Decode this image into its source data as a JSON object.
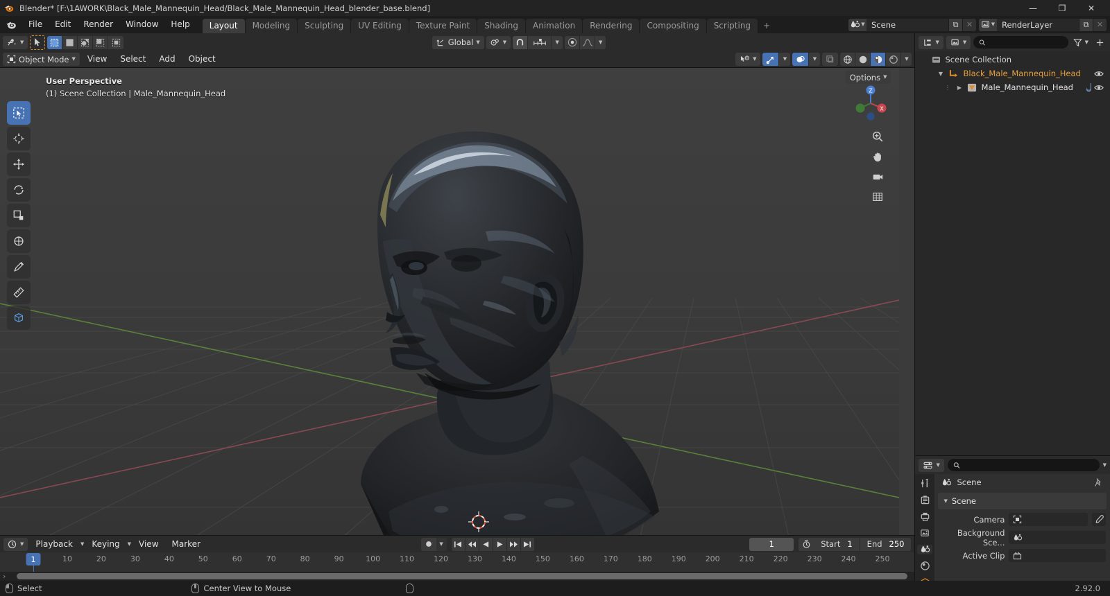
{
  "window": {
    "title": "Blender* [F:\\1AWORK\\Black_Male_Mannequin_Head/Black_Male_Mannequin_Head_blender_base.blend]",
    "minimize": "—",
    "maximize": "❐",
    "close": "✕"
  },
  "topbar": {
    "menus": [
      "File",
      "Edit",
      "Render",
      "Window",
      "Help"
    ],
    "tabs": [
      {
        "label": "Layout",
        "active": true
      },
      {
        "label": "Modeling",
        "active": false
      },
      {
        "label": "Sculpting",
        "active": false
      },
      {
        "label": "UV Editing",
        "active": false
      },
      {
        "label": "Texture Paint",
        "active": false
      },
      {
        "label": "Shading",
        "active": false
      },
      {
        "label": "Animation",
        "active": false
      },
      {
        "label": "Rendering",
        "active": false
      },
      {
        "label": "Compositing",
        "active": false
      },
      {
        "label": "Scripting",
        "active": false
      }
    ],
    "add_tab": "+",
    "scene": {
      "name": "Scene",
      "new_btn": "⧉",
      "unlink_btn": "✕"
    },
    "viewlayer": {
      "name": "RenderLayer",
      "new_btn": "⧉",
      "remove_btn": "✕"
    }
  },
  "viewport": {
    "mode": "Object Mode",
    "menus": [
      "View",
      "Select",
      "Add",
      "Object"
    ],
    "transform_orientation": "Global",
    "options_label": "Options",
    "overlay_line1": "User Perspective",
    "overlay_line2": "(1) Scene Collection | Male_Mannequin_Head",
    "gizmo_axes": {
      "x": "X",
      "y": "Y",
      "z": "Z"
    },
    "shading_modes": [
      "wireframe",
      "solid",
      "material-preview",
      "rendered"
    ],
    "active_shading_mode": "material-preview",
    "accent": "#4772b3",
    "grid_color": "#4a4a4a",
    "axis_x_color": "#9e4b5a",
    "axis_y_color": "#5d8a3a",
    "background": "#3b3b3b"
  },
  "timeline": {
    "editor_menus": [
      "Playback",
      "Keying",
      "View",
      "Marker"
    ],
    "current_frame": "1",
    "start_label": "Start",
    "start_value": "1",
    "end_label": "End",
    "end_value": "250",
    "ticks": [
      "1",
      "10",
      "20",
      "30",
      "40",
      "50",
      "60",
      "70",
      "80",
      "90",
      "100",
      "110",
      "120",
      "130",
      "140",
      "150",
      "160",
      "170",
      "180",
      "190",
      "200",
      "210",
      "220",
      "230",
      "240",
      "250"
    ],
    "playhead_frame": "1"
  },
  "outliner": {
    "search_placeholder": "",
    "rows": [
      {
        "label": "Scene Collection",
        "icon": "collection-icon",
        "depth": 0,
        "expander": "",
        "eye": true
      },
      {
        "label": "Black_Male_Mannequin_Head",
        "icon": "object-data-icon",
        "depth": 1,
        "expander": "▼",
        "eye": true
      },
      {
        "label": "Male_Mannequin_Head",
        "icon": "mesh-data-icon",
        "depth": 2,
        "expander": "▶",
        "eye": true
      }
    ]
  },
  "properties": {
    "breadcrumb": "Scene",
    "panel_title": "Scene",
    "rows": [
      {
        "label": "Camera",
        "value": "",
        "icon": "camera-icon"
      },
      {
        "label": "Background Sce...",
        "value": "",
        "icon": "scene-icon"
      },
      {
        "label": "Active Clip",
        "value": "",
        "icon": "clip-icon"
      }
    ],
    "tabs": [
      "tool-icon",
      "render-icon",
      "output-icon",
      "viewlayer-icon",
      "scene-icon",
      "world-icon",
      "object-icon"
    ]
  },
  "statusbar": {
    "items": [
      {
        "icon": "mouse-left-icon",
        "label": "Select"
      },
      {
        "icon": "mouse-middle-icon",
        "label": "Center View to Mouse"
      },
      {
        "icon": "mouse-right-icon",
        "label": ""
      }
    ],
    "version": "2.92.0"
  }
}
